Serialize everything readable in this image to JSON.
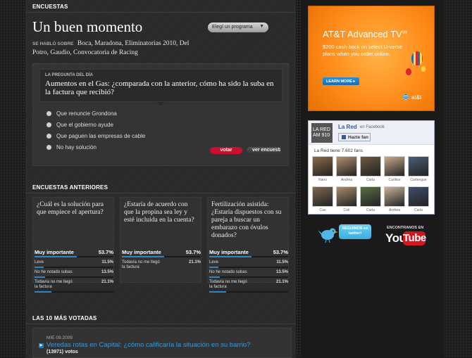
{
  "header": {
    "section": "ENCUESTAS"
  },
  "poll": {
    "title": "Un buen momento",
    "program_select": "Elegí un programa",
    "talked_label": "SE HABLÓ SOBRE",
    "talked_topics": "Boca, Maradona, Eliminatorias 2010, Del Potro, Gaudio, Convocatoria de Racing",
    "question_label": "LA PREGUNTA DEL DÍA",
    "question": "Aumentos en el Gas: ¿comparada con la anterior, cómo ha sido la suba en la factura que recibió?",
    "options": [
      "Que renuncie Grondona",
      "Que el gobierno ayude",
      "Que paguen las empresas de cable",
      "No hay solución"
    ],
    "vote_label": "votar",
    "results_label": "ver encuestas"
  },
  "previous": {
    "heading": "ENCUESTAS ANTERIORES",
    "cards": [
      {
        "question": "¿Cuál es la solución para que empiece el apertura?",
        "stats": [
          {
            "label": "Muy importante",
            "pct": "53.7%",
            "value": 53.7
          },
          {
            "label": "Leve",
            "pct": "11.5%",
            "value": 11.5
          },
          {
            "label": "No he notado subas",
            "pct": "13.5%",
            "value": 13.5
          },
          {
            "label": "Todavía no me llegó la factura",
            "pct": "21.1%",
            "value": 21.1
          }
        ]
      },
      {
        "question": "¿Estaría de acuerdo con que la propina sea ley y esté incluida en la cuenta?",
        "stats": [
          {
            "label": "Muy importante",
            "pct": "53.7%",
            "value": 53.7
          },
          {
            "label": "Todavía no me llegó la factura",
            "pct": "21.1%",
            "value": 21.1
          }
        ]
      },
      {
        "question": "Fertilización asistida: ¿Estaría dispuestos con su pareja a buscar un embarazo con óvulos donados?",
        "stats": [
          {
            "label": "Muy importante",
            "pct": "53.7%",
            "value": 53.7
          },
          {
            "label": "Leve",
            "pct": "11.5%",
            "value": 11.5
          },
          {
            "label": "No he notado subas",
            "pct": "13.5%",
            "value": 13.5
          },
          {
            "label": "Todavía no me llegó la factura",
            "pct": "21.1%",
            "value": 21.1
          }
        ]
      }
    ]
  },
  "top10": {
    "heading": "LAS 10 MÁS VOTADAS",
    "date": "MIE 09.2009",
    "title": "Veredas rotas en Capital: ¿cómo calificaría la situación en su barrio?",
    "votes": "(13971) votos"
  },
  "ad": {
    "title": "AT&T Advanced TV",
    "sup": "SM",
    "copy": "$200 cash back on select U-verse plans when you order online.",
    "button": "LEARN MORE ▸",
    "brand": "at&t"
  },
  "facebook": {
    "logo": "LA RED AM 910",
    "page_name": "La Red",
    "on": "en Facebook",
    "fan_button": "Hazte fan",
    "fan_count": "La Red tiene 7.602 fans",
    "fans": [
      "Nano",
      "Andrea",
      "Carla",
      "Carlitos",
      "Cartengue",
      "Cau",
      "Coti",
      "Carla",
      "Andrea",
      "Carla"
    ],
    "face_colors": [
      "#8a6b4a",
      "#b08f70",
      "#6d5840",
      "#c9a98a",
      "#4a5f78",
      "#7a6852",
      "#a88c6c",
      "#596c45",
      "#c7b39a",
      "#3d4f6a"
    ]
  },
  "social": {
    "twitter_badge": "SEGUINOS en twitter!",
    "youtube_label": "ENCONTRANOS EN",
    "youtube_you": "You",
    "youtube_tube": "Tube"
  },
  "colors": {
    "accent_blue": "#2a86c8",
    "vote_red": "#c8102e",
    "ad_orange": "#ff8c1a"
  }
}
